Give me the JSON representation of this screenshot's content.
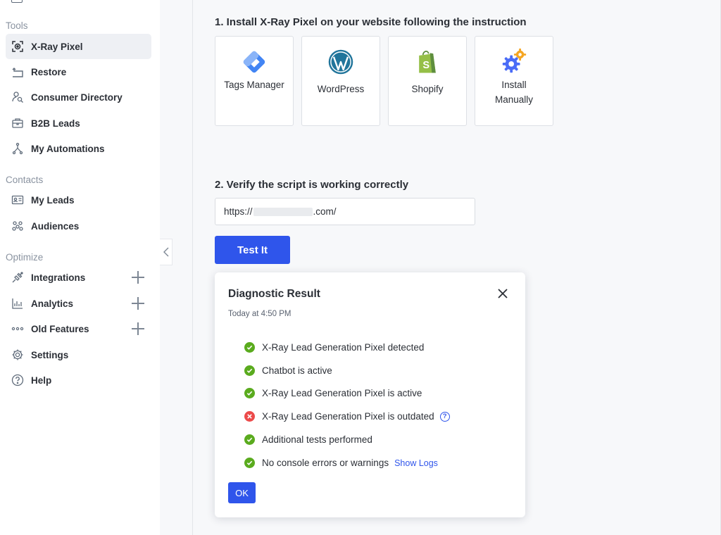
{
  "sidebar": {
    "sections": {
      "tools": "Tools",
      "contacts": "Contacts",
      "optimize": "Optimize"
    },
    "items": {
      "xray_pixel": "X-Ray Pixel",
      "restore": "Restore",
      "consumer_directory": "Consumer Directory",
      "b2b_leads": "B2B Leads",
      "my_automations": "My Automations",
      "my_leads": "My Leads",
      "audiences": "Audiences",
      "integrations": "Integrations",
      "analytics": "Analytics",
      "old_features": "Old Features",
      "settings": "Settings",
      "help": "Help"
    },
    "active_item": "X-Ray Pixel"
  },
  "main": {
    "step1_title": "1. Install X-Ray Pixel on your website following the instruction",
    "install_options": [
      {
        "label": "Tags Manager",
        "icon": "google-tag-manager-icon"
      },
      {
        "label": "WordPress",
        "icon": "wordpress-icon"
      },
      {
        "label": "Shopify",
        "icon": "shopify-icon"
      },
      {
        "label": "Install Manually",
        "icon": "gears-icon"
      }
    ],
    "step2_title": "2. Verify the script is working correctly",
    "url_prefix": "https://",
    "url_suffix": ".com/",
    "test_button": "Test It"
  },
  "dialog": {
    "title": "Diagnostic Result",
    "timestamp": "Today at 4:50 PM",
    "results": [
      {
        "text": "X-Ray Lead Generation Pixel detected",
        "status": "pass"
      },
      {
        "text": "Chatbot is active",
        "status": "pass"
      },
      {
        "text": "X-Ray Lead Generation Pixel is active",
        "status": "pass"
      },
      {
        "text": "X-Ray Lead Generation Pixel is outdated",
        "status": "fail"
      },
      {
        "text": "Additional tests performed",
        "status": "pass"
      },
      {
        "text": "No console errors or warnings",
        "status": "pass"
      }
    ],
    "help_glyph": "?",
    "show_logs": "Show Logs",
    "ok_button": "OK"
  },
  "colors": {
    "accent": "#2f55eb",
    "pass": "#5aab1e",
    "fail": "#ec4a4a",
    "gtm": "#4285f4",
    "wordpress": "#21759b",
    "shopify": "#95bf47"
  }
}
